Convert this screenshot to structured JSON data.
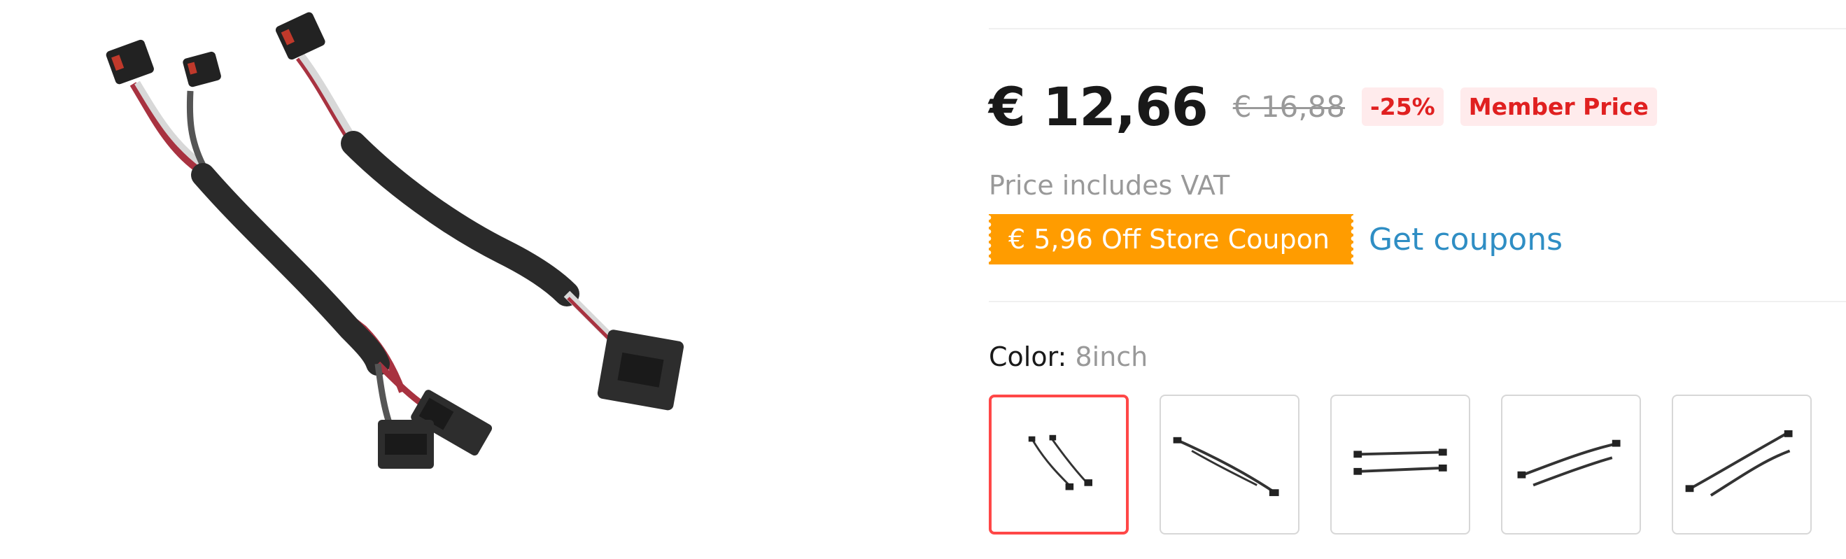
{
  "product": {
    "image_alt": "cable harness product photo",
    "price_current": "€ 12,66",
    "price_original": "€ 16,88",
    "discount_badge": "-25%",
    "member_badge": "Member Price",
    "vat_note": "Price includes VAT",
    "coupon_label": "€ 5,96 Off Store Coupon",
    "get_coupons_label": "Get coupons"
  },
  "variants": {
    "label": "Color:",
    "selected_value": "8inch",
    "options": [
      {
        "selected": true
      },
      {
        "selected": false
      },
      {
        "selected": false
      },
      {
        "selected": false
      },
      {
        "selected": false
      }
    ]
  },
  "colors": {
    "price_text": "#191919",
    "muted_text": "#999999",
    "badge_bg": "#ffebec",
    "badge_text": "#e02020",
    "coupon_bg": "#ff9c00",
    "link": "#2f8ec4",
    "selected_border": "#ff4747"
  }
}
